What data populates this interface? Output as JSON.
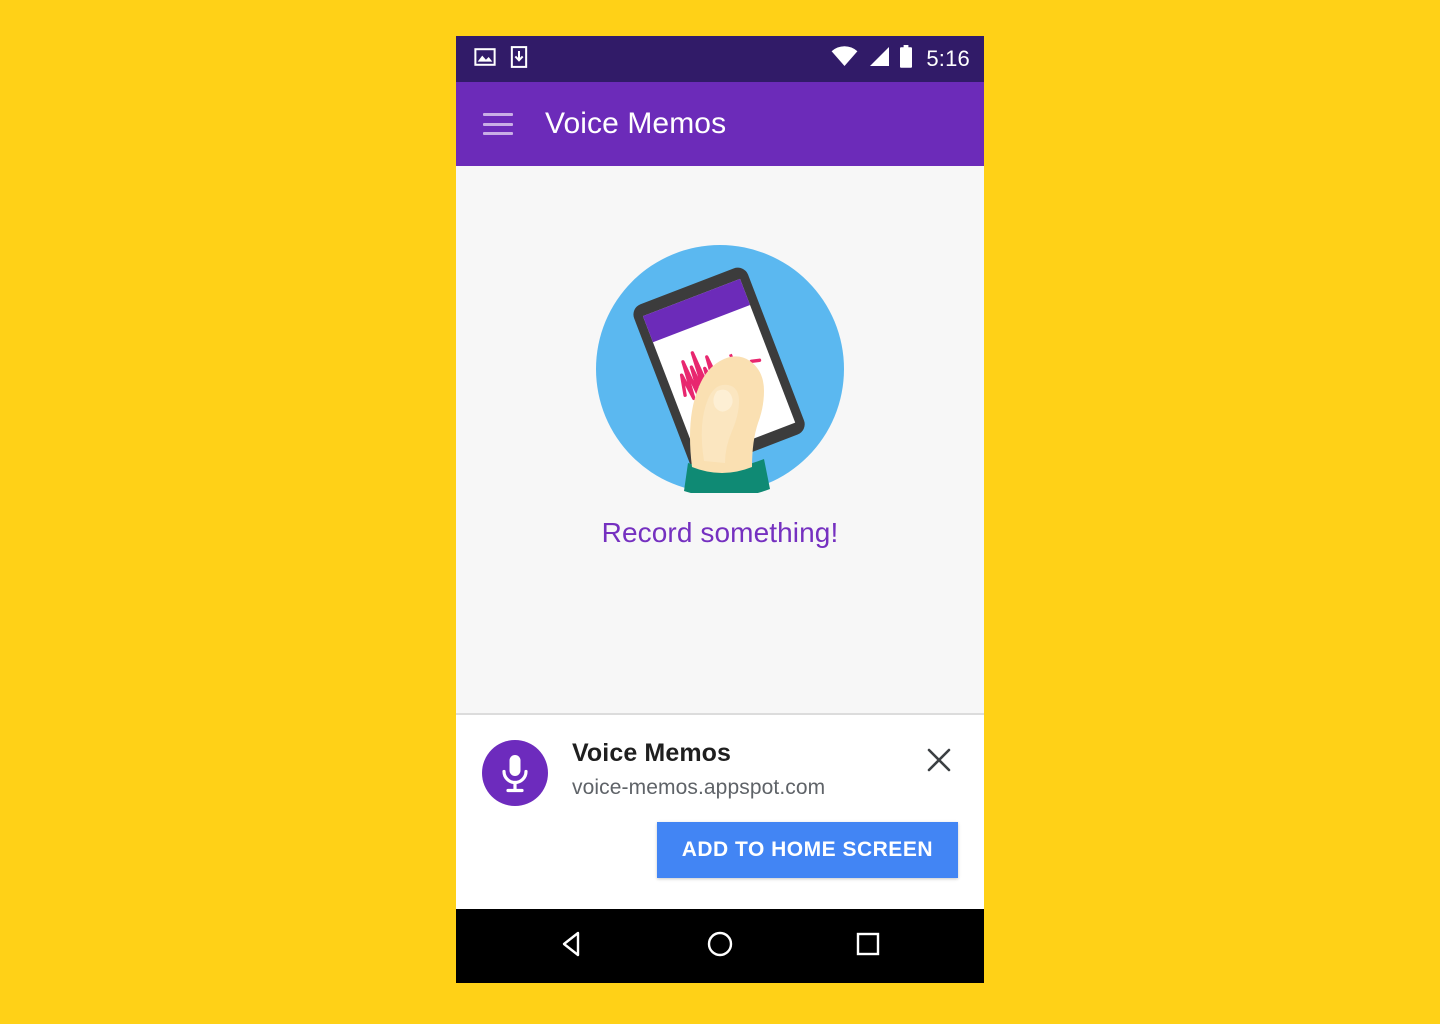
{
  "page": {
    "background_color": "#FFD117"
  },
  "status_bar": {
    "background_color": "#311B68",
    "time": "5:16",
    "left_icons": [
      {
        "name": "image-icon"
      },
      {
        "name": "download-icon"
      }
    ],
    "right_icons": [
      {
        "name": "wifi-icon"
      },
      {
        "name": "cellular-signal-icon"
      },
      {
        "name": "battery-icon"
      }
    ]
  },
  "app_bar": {
    "background_color": "#6C2BB9",
    "menu_icon": "hamburger-menu-icon",
    "title": "Voice Memos"
  },
  "content": {
    "background_color": "#F7F7F7",
    "illustration": {
      "name": "hand-holding-phone-illustration",
      "circle_color": "#5BB8F0",
      "skin_color": "#FAE0B2",
      "sleeve_color": "#0F8A74",
      "phone_body_color": "#3C3C3C",
      "phone_screen_color": "#FFFFFF",
      "phone_header_color": "#6C2BB9",
      "waveform_color": "#E8276F"
    },
    "empty_state_text": "Record something!",
    "empty_state_text_color": "#7530C0"
  },
  "install_banner": {
    "background_color": "#FFFFFF",
    "app_icon": {
      "name": "microphone-icon",
      "circle_color": "#6D2BBD"
    },
    "app_name": "Voice Memos",
    "app_url": "voice-memos.appspot.com",
    "close_label": "close-icon",
    "button_label": "ADD TO HOME SCREEN",
    "button_color": "#4285F4"
  },
  "nav_bar": {
    "background_color": "#000000",
    "buttons": [
      {
        "name": "back-button",
        "icon": "triangle-left-icon"
      },
      {
        "name": "home-button",
        "icon": "circle-icon"
      },
      {
        "name": "recents-button",
        "icon": "square-icon"
      }
    ]
  }
}
